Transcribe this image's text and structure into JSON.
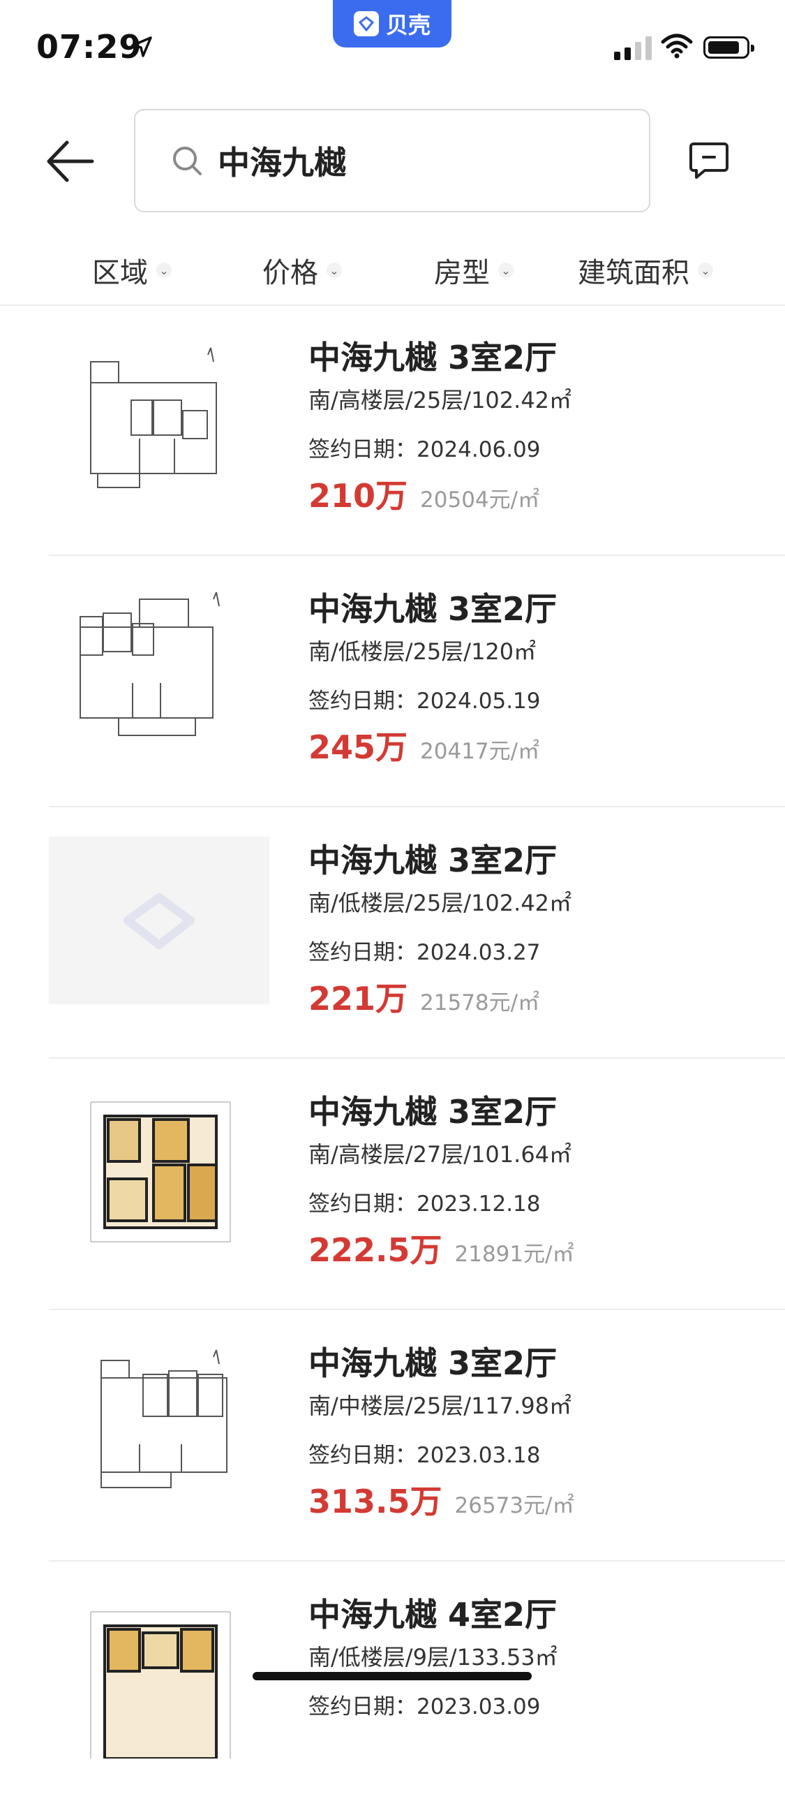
{
  "status_bar": {
    "time": "07:29",
    "app_badge": "贝壳"
  },
  "header": {
    "search_text": "中海九樾"
  },
  "filters": [
    {
      "label": "区域"
    },
    {
      "label": "价格"
    },
    {
      "label": "房型"
    },
    {
      "label": "建筑面积"
    }
  ],
  "listings": [
    {
      "title": "中海九樾 3室2厅",
      "info": "南/高楼层/25层/102.42㎡",
      "date": "签约日期：2024.06.09",
      "total_price": "210万",
      "unit_price": "20504元/㎡",
      "thumb": "floorplan-sketch"
    },
    {
      "title": "中海九樾 3室2厅",
      "info": "南/低楼层/25层/120㎡",
      "date": "签约日期：2024.05.19",
      "total_price": "245万",
      "unit_price": "20417元/㎡",
      "thumb": "floorplan-sketch"
    },
    {
      "title": "中海九樾 3室2厅",
      "info": "南/低楼层/25层/102.42㎡",
      "date": "签约日期：2024.03.27",
      "total_price": "221万",
      "unit_price": "21578元/㎡",
      "thumb": "placeholder"
    },
    {
      "title": "中海九樾 3室2厅",
      "info": "南/高楼层/27层/101.64㎡",
      "date": "签约日期：2023.12.18",
      "total_price": "222.5万",
      "unit_price": "21891元/㎡",
      "thumb": "floorplan-color"
    },
    {
      "title": "中海九樾 3室2厅",
      "info": "南/中楼层/25层/117.98㎡",
      "date": "签约日期：2023.03.18",
      "total_price": "313.5万",
      "unit_price": "26573元/㎡",
      "thumb": "floorplan-sketch"
    },
    {
      "title": "中海九樾 4室2厅",
      "info": "南/低楼层/9层/133.53㎡",
      "date": "签约日期：2023.03.09",
      "total_price": "",
      "unit_price": "",
      "thumb": "floorplan-color"
    }
  ],
  "colors": {
    "price_red": "#d33a33",
    "brand_blue": "#3b6cf0"
  }
}
